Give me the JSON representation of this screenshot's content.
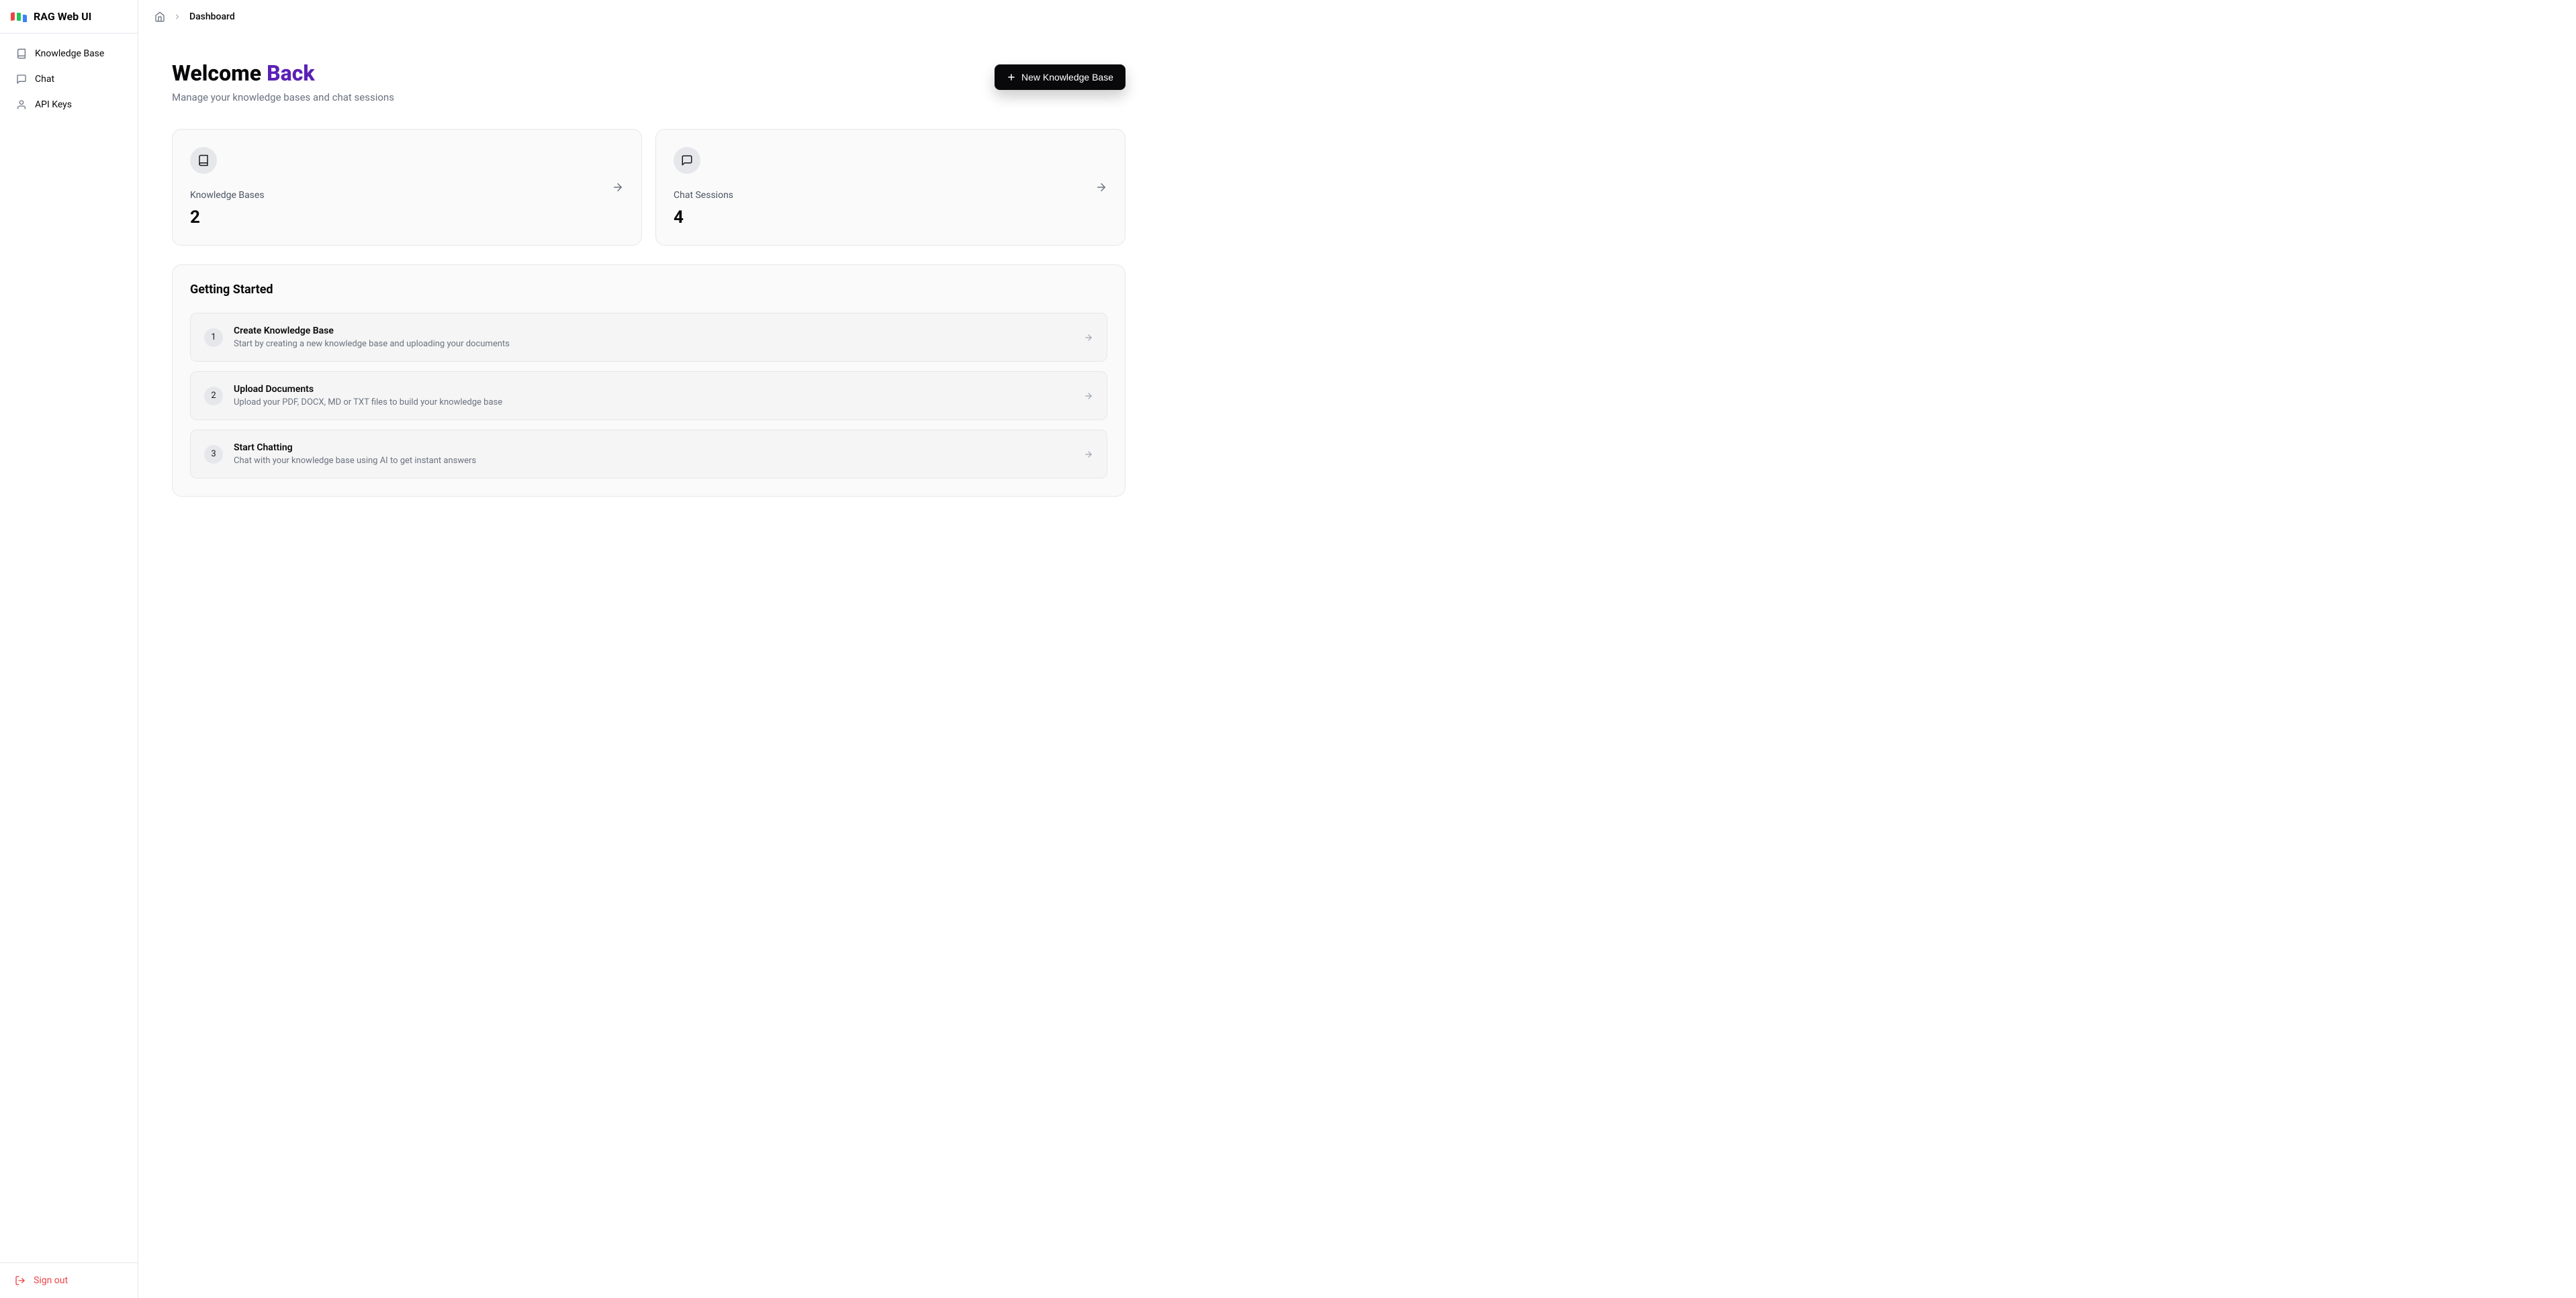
{
  "app": {
    "title": "RAG Web UI"
  },
  "sidebar": {
    "items": [
      {
        "label": "Knowledge Base"
      },
      {
        "label": "Chat"
      },
      {
        "label": "API Keys"
      }
    ],
    "signout": "Sign out"
  },
  "breadcrumb": {
    "current": "Dashboard"
  },
  "header": {
    "welcome": "Welcome ",
    "back": "Back",
    "subtitle": "Manage your knowledge bases and chat sessions",
    "new_kb_label": "New Knowledge Base"
  },
  "stats": [
    {
      "label": "Knowledge Bases",
      "value": "2"
    },
    {
      "label": "Chat Sessions",
      "value": "4"
    }
  ],
  "getting_started": {
    "title": "Getting Started",
    "steps": [
      {
        "num": "1",
        "title": "Create Knowledge Base",
        "desc": "Start by creating a new knowledge base and uploading your documents"
      },
      {
        "num": "2",
        "title": "Upload Documents",
        "desc": "Upload your PDF, DOCX, MD or TXT files to build your knowledge base"
      },
      {
        "num": "3",
        "title": "Start Chatting",
        "desc": "Chat with your knowledge base using AI to get instant answers"
      }
    ]
  }
}
